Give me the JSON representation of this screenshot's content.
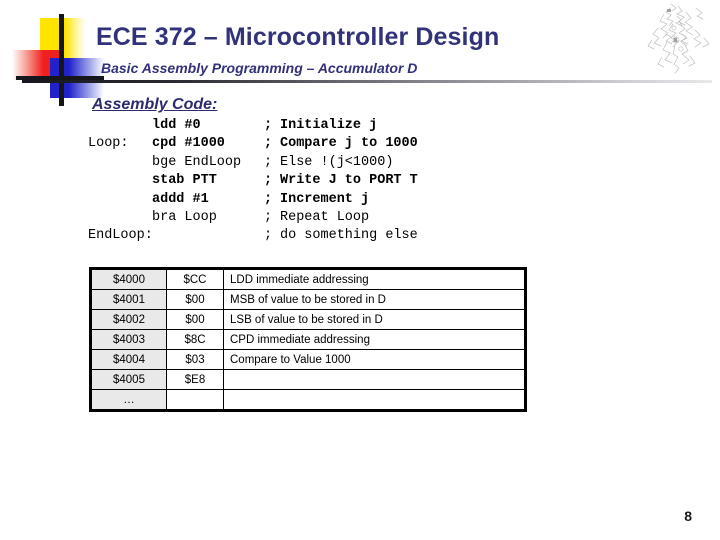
{
  "header": {
    "title": "ECE 372 – Microcontroller Design",
    "subtitle": "Basic Assembly Programming – Accumulator D",
    "title_color": "#32327a",
    "rule_color": "#17171f"
  },
  "section": {
    "heading": "Assembly Code:"
  },
  "code": {
    "comment_marker": ";",
    "lines": [
      {
        "label": "",
        "instruction": "ldd #0",
        "comment": "Initialize j",
        "bold": true
      },
      {
        "label": "Loop:",
        "instruction": "cpd #1000",
        "comment": "Compare j to 1000",
        "bold": true
      },
      {
        "label": "",
        "instruction": "bge EndLoop",
        "comment": "Else !(j<1000)",
        "bold": false
      },
      {
        "label": "",
        "instruction": "stab PTT",
        "comment": "Write J to PORT T",
        "bold": true
      },
      {
        "label": "",
        "instruction": "addd #1",
        "comment": "Increment j",
        "bold": true
      },
      {
        "label": "",
        "instruction": "bra Loop",
        "comment": "Repeat Loop",
        "bold": false
      },
      {
        "label": "EndLoop:",
        "instruction": "",
        "comment": "do something else",
        "bold": false
      }
    ]
  },
  "memory_table": {
    "address_fill": "#e9e9e9",
    "rows": [
      {
        "address": "$4000",
        "value": "$CC",
        "description": "LDD immediate addressing"
      },
      {
        "address": "$4001",
        "value": "$00",
        "description": "MSB of value to be stored in D"
      },
      {
        "address": "$4002",
        "value": "$00",
        "description": "LSB of value to be stored in D"
      },
      {
        "address": "$4003",
        "value": "$8C",
        "description": "CPD immediate addressing"
      },
      {
        "address": "$4004",
        "value": "$03",
        "description": "Compare to Value 1000"
      },
      {
        "address": "$4005",
        "value": "$E8",
        "description": ""
      },
      {
        "address": "…",
        "value": "",
        "description": ""
      }
    ]
  },
  "footer": {
    "page_number": "8"
  },
  "decor": {
    "logo_icon": "logo-squares-crosshair-icon",
    "scribble_icon": "scribble-sketch-icon"
  }
}
